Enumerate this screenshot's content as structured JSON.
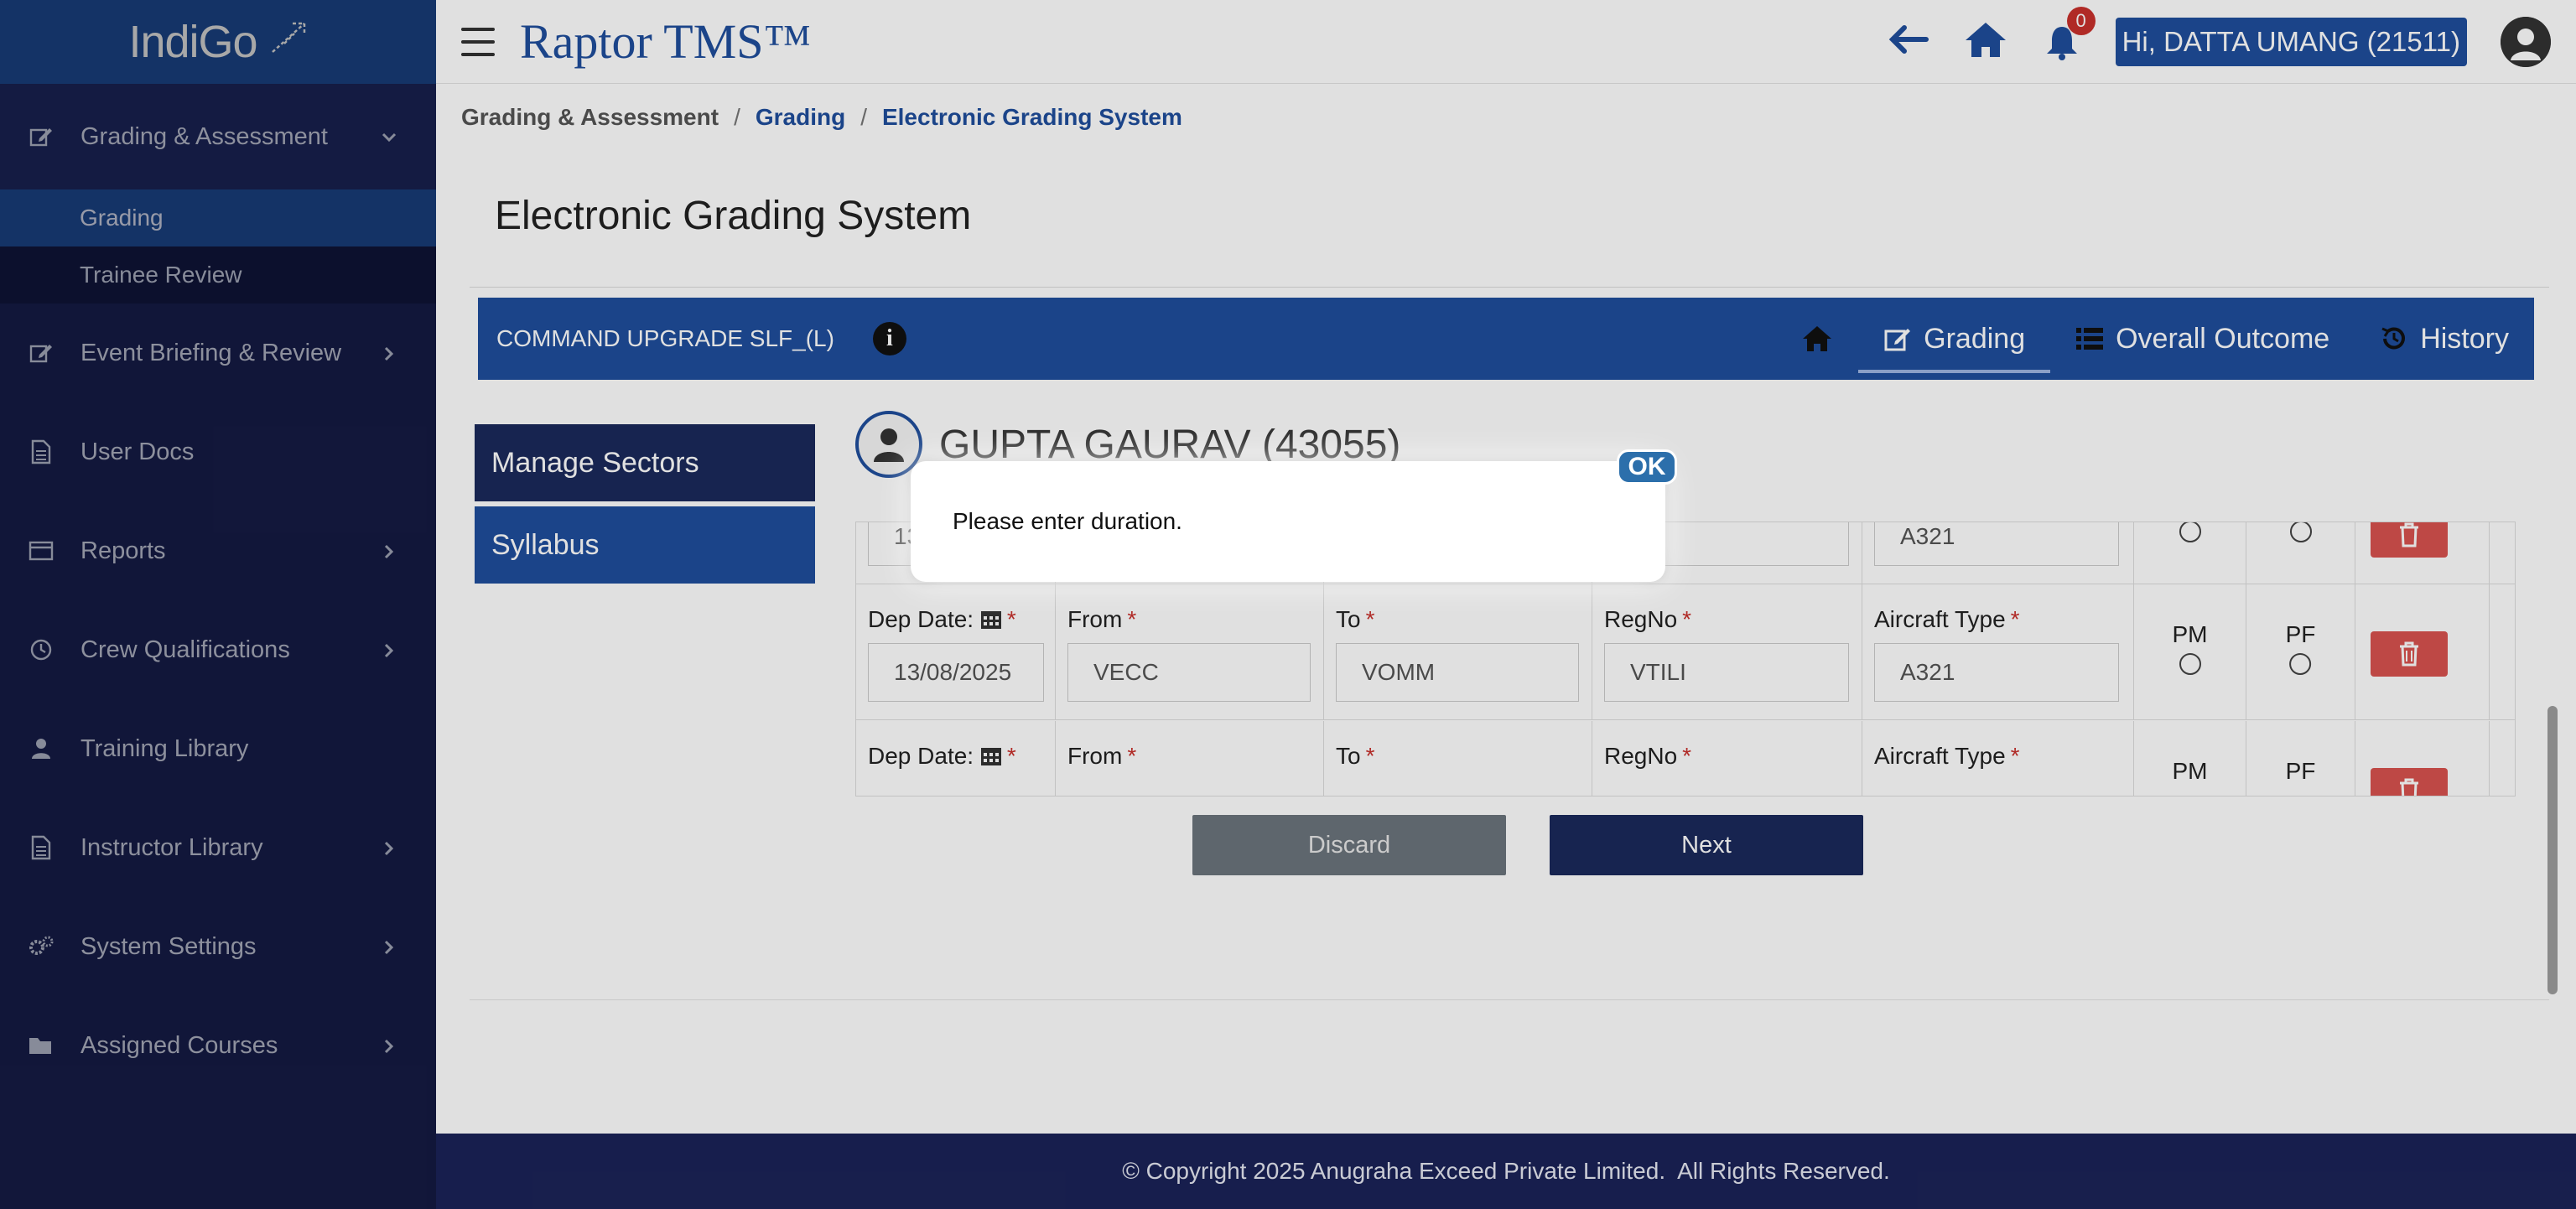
{
  "brand": {
    "name": "IndiGo"
  },
  "header": {
    "app_title": "Raptor TMS™",
    "notification_count": "0",
    "user_greeting": "Hi, DATTA UMANG (21511)"
  },
  "sidebar": {
    "items": [
      {
        "label": "Grading & Assessment",
        "icon": "edit-icon"
      },
      {
        "label": "Event Briefing & Review",
        "icon": "edit-icon"
      },
      {
        "label": "User Docs",
        "icon": "document-icon"
      },
      {
        "label": "Reports",
        "icon": "report-icon"
      },
      {
        "label": "Crew Qualifications",
        "icon": "clock-icon"
      },
      {
        "label": "Training Library",
        "icon": "user-icon"
      },
      {
        "label": "Instructor Library",
        "icon": "document-icon"
      },
      {
        "label": "System Settings",
        "icon": "gears-icon"
      },
      {
        "label": "Assigned Courses",
        "icon": "folder-icon"
      }
    ],
    "sub_items": [
      {
        "label": "Grading"
      },
      {
        "label": "Trainee Review"
      }
    ]
  },
  "breadcrumb": {
    "items": [
      "Grading & Assessment",
      "Grading",
      "Electronic Grading System"
    ],
    "separator": "/"
  },
  "page": {
    "title": "Electronic Grading System",
    "course": "COMMAND UPGRADE SLF_(L)",
    "tabs": [
      {
        "label": ""
      },
      {
        "label": "Grading"
      },
      {
        "label": "Overall Outcome"
      },
      {
        "label": "History"
      }
    ],
    "left_menu": [
      "Manage Sectors",
      "Syllabus"
    ],
    "trainee_name": "GUPTA GAURAV (43055)"
  },
  "sectors": {
    "labels": {
      "dep_date": "Dep Date:",
      "from": "From",
      "to": "To",
      "regno": "RegNo",
      "aircraft_type": "Aircraft Type",
      "pm": "PM",
      "pf": "PF",
      "required": "*"
    },
    "rows": [
      {
        "dep_date": "13/08/2025",
        "from": "",
        "to": "",
        "regno": "LI",
        "aircraft_type": "A321"
      },
      {
        "dep_date": "13/08/2025",
        "from": "VECC",
        "to": "VOMM",
        "regno": "VTILI",
        "aircraft_type": "A321"
      },
      {
        "dep_date": "",
        "from": "",
        "to": "",
        "regno": "",
        "aircraft_type": ""
      }
    ]
  },
  "actions": {
    "discard": "Discard",
    "next": "Next"
  },
  "footer": {
    "copyright": "© Copyright 2025 Anugraha Exceed Private Limited.  All Rights Reserved."
  },
  "dialog": {
    "message": "Please enter duration.",
    "ok": "OK"
  },
  "colors": {
    "brand_blue": "#1f4e9c",
    "sidebar_navy": "#1b2358",
    "danger": "#d9534f"
  }
}
